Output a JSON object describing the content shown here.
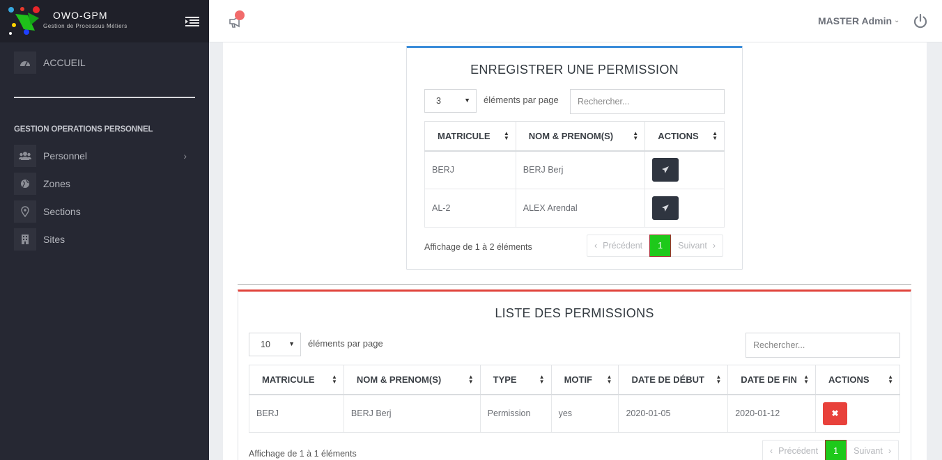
{
  "brand": {
    "title": "OWO-GPM",
    "subtitle": "Gestion de Processus Métiers"
  },
  "sidebar": {
    "home": {
      "label": "ACCUEIL",
      "icon": "dashboard-icon"
    },
    "section_title": "GESTION OPERATIONS PERSONNEL",
    "items": [
      {
        "label": "Personnel",
        "icon": "users-icon",
        "has_children": true
      },
      {
        "label": "Zones",
        "icon": "globe-icon"
      },
      {
        "label": "Sections",
        "icon": "map-pin-icon"
      },
      {
        "label": "Sites",
        "icon": "building-icon"
      }
    ]
  },
  "topbar": {
    "user_name": "MASTER Admin"
  },
  "register_card": {
    "title": "ENREGISTRER UNE PERMISSION",
    "page_size": "3",
    "per_page_label": "éléments par page",
    "search_placeholder": "Rechercher...",
    "columns": [
      "MATRICULE",
      "NOM & PRENOM(S)",
      "ACTIONS"
    ],
    "rows": [
      {
        "matricule": "BERJ",
        "nom": "BERJ Berj"
      },
      {
        "matricule": "AL-2",
        "nom": "ALEX Arendal"
      }
    ],
    "info": "Affichage de 1 à 2 éléments",
    "pager": {
      "prev": "Précédent",
      "current": "1",
      "next": "Suivant"
    }
  },
  "list_card": {
    "title": "LISTE DES PERMISSIONS",
    "page_size": "10",
    "per_page_label": "éléments par page",
    "search_placeholder": "Rechercher...",
    "columns": [
      "MATRICULE",
      "NOM & PRENOM(S)",
      "TYPE",
      "MOTIF",
      "DATE DE DÉBUT",
      "DATE DE FIN",
      "ACTIONS"
    ],
    "rows": [
      {
        "matricule": "BERJ",
        "nom": "BERJ Berj",
        "type": "Permission",
        "motif": "yes",
        "debut": "2020-01-05",
        "fin": "2020-01-12"
      }
    ],
    "info": "Affichage de 1 à 1 éléments",
    "pager": {
      "prev": "Précédent",
      "current": "1",
      "next": "Suivant"
    }
  },
  "colors": {
    "sidebar": "#262833",
    "primary_border": "#3c8dda",
    "danger_border": "#e0433a",
    "active_page": "#1ec91a",
    "send_button": "#2f3540",
    "delete_button": "#e8413b"
  }
}
